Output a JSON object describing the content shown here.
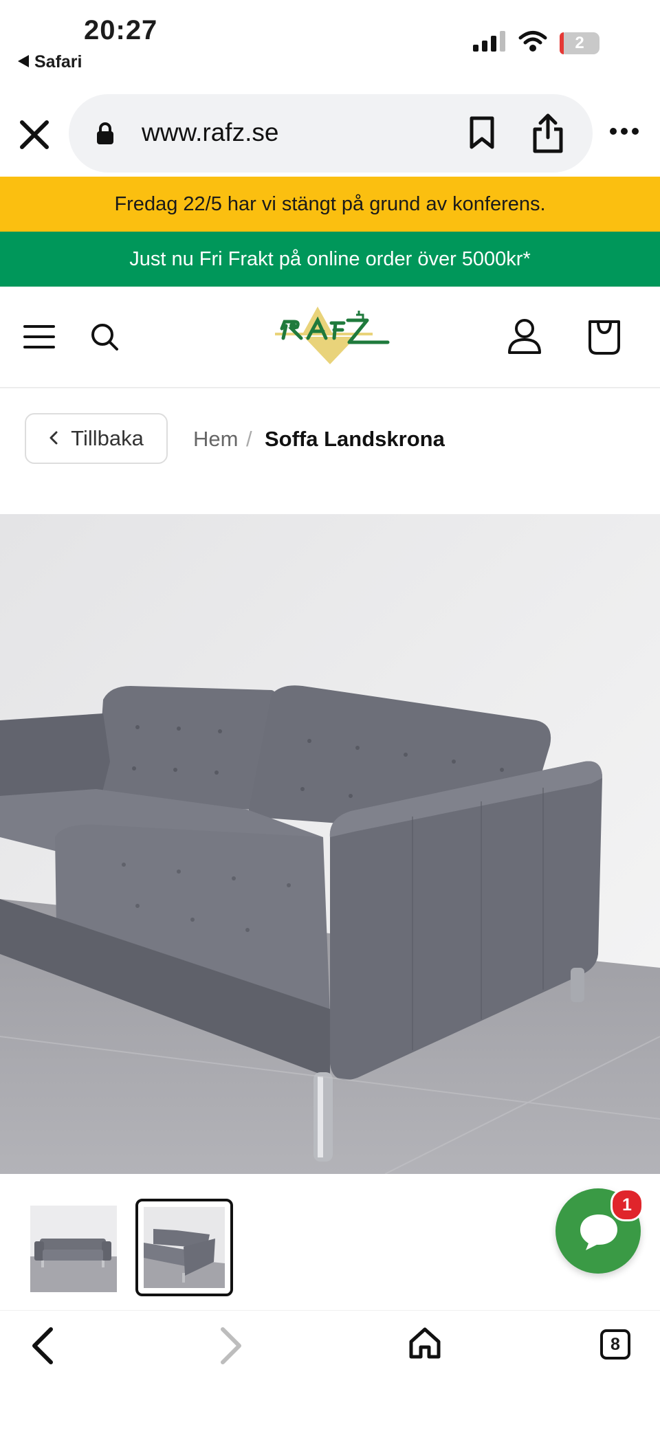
{
  "status_bar": {
    "time": "20:27",
    "back_app": "Safari",
    "battery": "2"
  },
  "browser": {
    "url": "www.rafz.se",
    "tab_count": "8"
  },
  "banners": {
    "notice": "Fredag 22/5 har vi stängt på grund av konferens.",
    "shipping": "Just nu Fri Frakt på online order över 5000kr*"
  },
  "header": {
    "logo_text": "RAFZ"
  },
  "breadcrumb": {
    "back_label": "Tillbaka",
    "home": "Hem",
    "separator": "/",
    "current": "Soffa Landskrona"
  },
  "chat": {
    "badge": "1"
  },
  "colors": {
    "notice_banner": "#fbbf10",
    "shipping_banner": "#00975a",
    "chat_button": "#3a9a45",
    "badge": "#e0252b",
    "logo_green": "#1f7a3c",
    "logo_yellow": "#e9d37a"
  },
  "icons": [
    "close-icon",
    "lock-icon",
    "bookmark-icon",
    "share-icon",
    "more-icon",
    "menu-icon",
    "search-icon",
    "account-icon",
    "cart-icon",
    "chevron-left-icon",
    "chat-icon",
    "back-arrow-icon",
    "forward-arrow-icon",
    "home-icon",
    "tabs-icon"
  ]
}
